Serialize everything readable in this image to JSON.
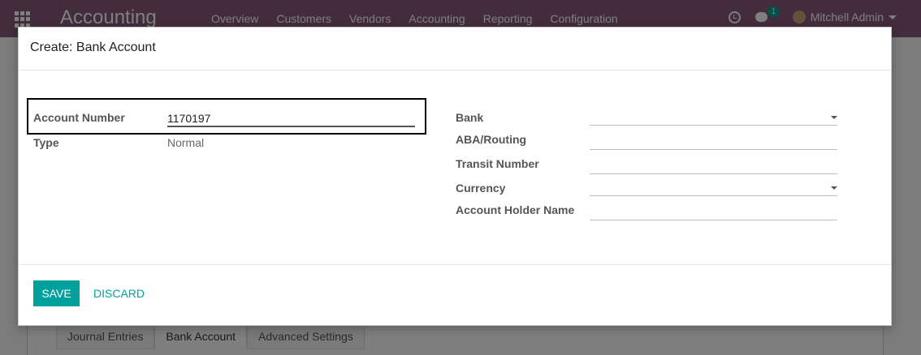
{
  "navbar": {
    "brand": "Accounting",
    "menu": [
      "Overview",
      "Customers",
      "Vendors",
      "Accounting",
      "Reporting",
      "Configuration"
    ],
    "chat_badge": "1",
    "user_name": "Mitchell Admin"
  },
  "background_tabs": [
    "Journal Entries",
    "Bank Account",
    "Advanced Settings"
  ],
  "modal": {
    "title": "Create: Bank Account",
    "left_fields": {
      "account_number_label": "Account Number",
      "account_number_value": "1170197",
      "type_label": "Type",
      "type_value": "Normal"
    },
    "right_fields": {
      "bank_label": "Bank",
      "aba_label": "ABA/Routing",
      "transit_label": "Transit Number",
      "currency_label": "Currency",
      "holder_label": "Account Holder Name"
    },
    "save_label": "SAVE",
    "discard_label": "DISCARD"
  },
  "colors": {
    "navbar": "#875a7b",
    "primary": "#00a09d"
  }
}
